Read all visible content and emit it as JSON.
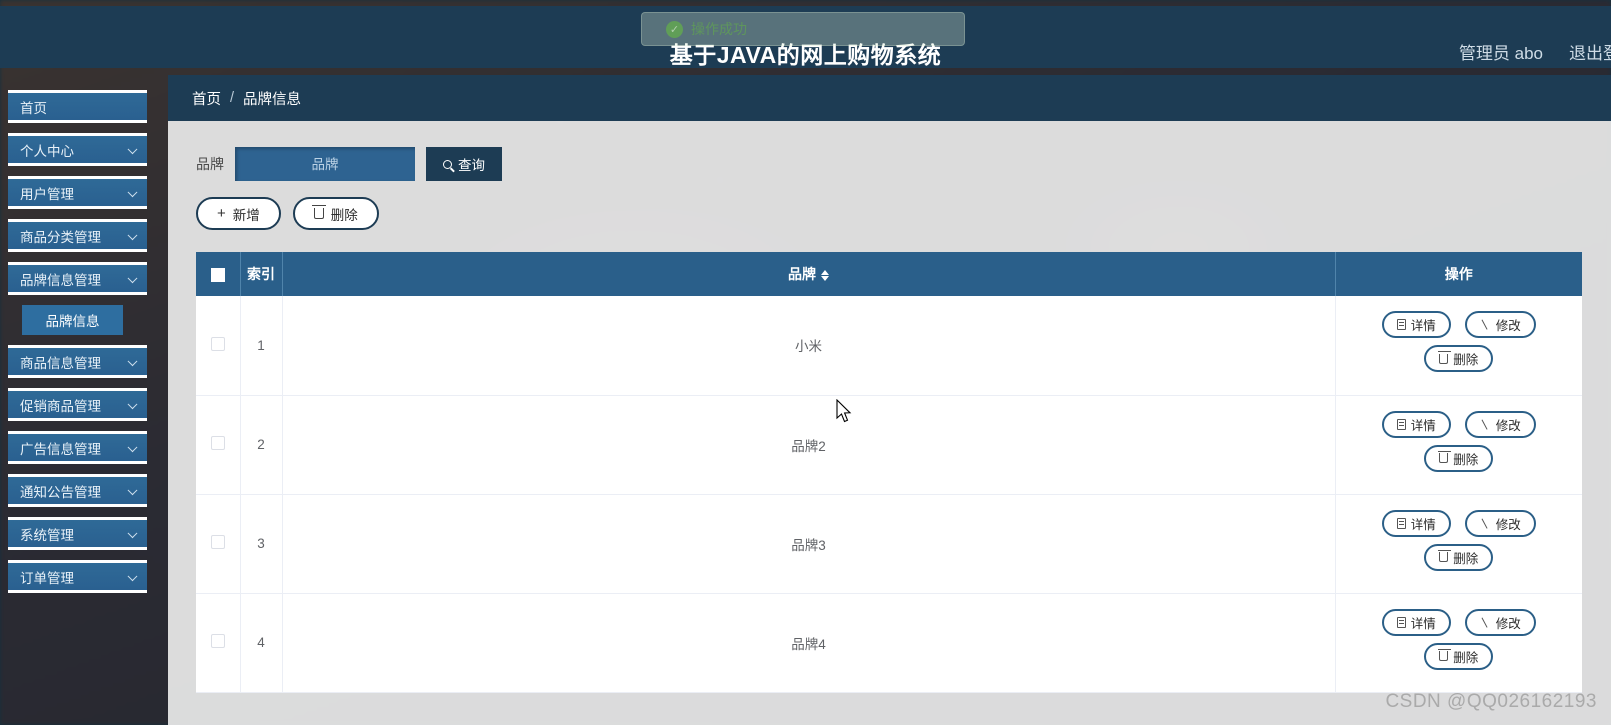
{
  "header": {
    "title": "基于JAVA的网上购物系统",
    "user_label": "管理员 abo",
    "logout_label": "退出登录"
  },
  "toast": {
    "message": "操作成功",
    "icon": "check-circle-icon",
    "color": "#67c23a"
  },
  "sidebar": {
    "items": [
      {
        "label": "首页",
        "expandable": false,
        "active": false
      },
      {
        "label": "个人中心",
        "expandable": true,
        "active": false
      },
      {
        "label": "用户管理",
        "expandable": true,
        "active": false
      },
      {
        "label": "商品分类管理",
        "expandable": true,
        "active": false
      },
      {
        "label": "品牌信息管理",
        "expandable": true,
        "active": true
      },
      {
        "label": "商品信息管理",
        "expandable": true,
        "active": false
      },
      {
        "label": "促销商品管理",
        "expandable": true,
        "active": false
      },
      {
        "label": "广告信息管理",
        "expandable": true,
        "active": false
      },
      {
        "label": "通知公告管理",
        "expandable": true,
        "active": false
      },
      {
        "label": "系统管理",
        "expandable": true,
        "active": false
      },
      {
        "label": "订单管理",
        "expandable": true,
        "active": false
      }
    ],
    "submenu": {
      "label": "品牌信息",
      "parent_index": 4
    }
  },
  "breadcrumb": {
    "home": "首页",
    "separator": "/",
    "current": "品牌信息"
  },
  "filter": {
    "label": "品牌",
    "input_placeholder": "品牌",
    "input_value": "",
    "search_label": "查询",
    "search_icon": "search-icon"
  },
  "actions": {
    "add_label": "新增",
    "add_icon": "plus-icon",
    "delete_label": "删除",
    "delete_icon": "trash-icon"
  },
  "table": {
    "columns": {
      "select_all": "",
      "index": "索引",
      "brand": "品牌",
      "operation": "操作"
    },
    "sort_icon": "sort-arrows-icon",
    "rows": [
      {
        "index": "1",
        "brand": "小米",
        "checked": false
      },
      {
        "index": "2",
        "brand": "品牌2",
        "checked": false
      },
      {
        "index": "3",
        "brand": "品牌3",
        "checked": false
      },
      {
        "index": "4",
        "brand": "品牌4",
        "checked": false
      }
    ],
    "row_actions": {
      "detail_label": "详情",
      "detail_icon": "document-icon",
      "edit_label": "修改",
      "edit_icon": "pencil-icon",
      "delete_label": "删除",
      "delete_icon": "trash-icon"
    }
  },
  "watermark": "CSDN @QQ026162193",
  "colors": {
    "header_bg": "#1d3c54",
    "sidebar_item": "#2a6090",
    "table_header": "#2a5f8a",
    "accent_border": "#1d3c54",
    "panel_bg": "#e9e9e9"
  }
}
